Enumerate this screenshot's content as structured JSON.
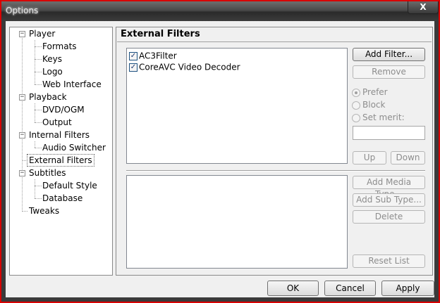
{
  "window": {
    "title": "Options",
    "close_glyph": "X"
  },
  "tree": {
    "player": "Player",
    "formats": "Formats",
    "keys": "Keys",
    "logo": "Logo",
    "web_interface": "Web Interface",
    "playback": "Playback",
    "dvd_ogm": "DVD/OGM",
    "output": "Output",
    "internal_filters": "Internal Filters",
    "audio_switcher": "Audio Switcher",
    "external_filters": "External Filters",
    "subtitles": "Subtitles",
    "default_style": "Default Style",
    "database": "Database",
    "tweaks": "Tweaks",
    "expanded_glyph": "−",
    "selected": "external_filters"
  },
  "page": {
    "title": "External Filters",
    "filters": [
      {
        "label": "AC3Filter",
        "checked": true
      },
      {
        "label": "CoreAVC Video Decoder",
        "checked": true
      }
    ],
    "check_glyph": "✓",
    "buttons": {
      "add_filter": "Add Filter...",
      "remove": "Remove",
      "up": "Up",
      "down": "Down",
      "add_media_type": "Add Media Type...",
      "add_sub_type": "Add Sub Type...",
      "delete": "Delete",
      "reset_list": "Reset List"
    },
    "merit": {
      "prefer": "Prefer",
      "block": "Block",
      "set_merit": "Set merit:",
      "selected": "prefer",
      "value": ""
    }
  },
  "dialog_buttons": {
    "ok": "OK",
    "cancel": "Cancel",
    "apply": "Apply"
  }
}
